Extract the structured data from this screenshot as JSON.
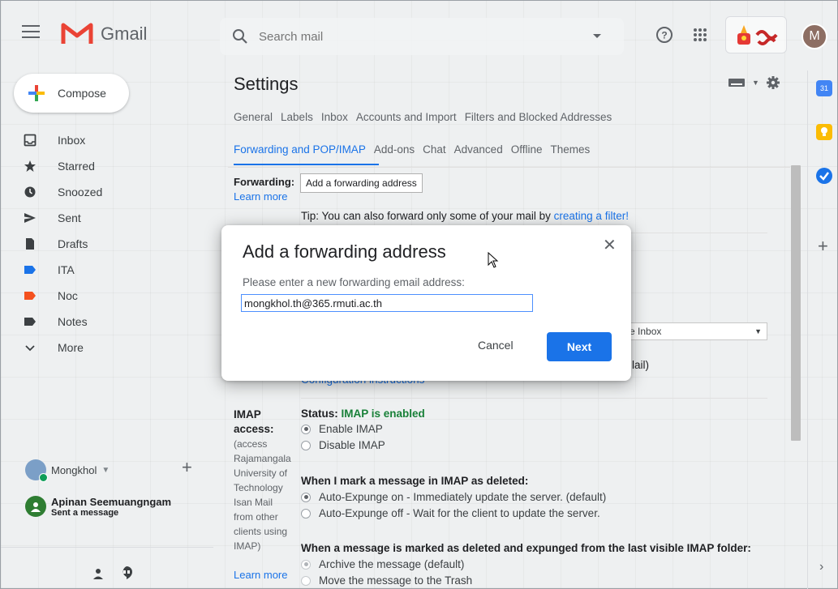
{
  "app": {
    "name": "Gmail"
  },
  "search": {
    "placeholder": "Search mail"
  },
  "compose": {
    "label": "Compose"
  },
  "nav": [
    {
      "label": "Inbox",
      "icon": "inbox-icon"
    },
    {
      "label": "Starred",
      "icon": "star-icon"
    },
    {
      "label": "Snoozed",
      "icon": "clock-icon"
    },
    {
      "label": "Sent",
      "icon": "send-icon"
    },
    {
      "label": "Drafts",
      "icon": "draft-icon"
    },
    {
      "label": "ITA",
      "icon": "label-icon",
      "color": "#1a73e8"
    },
    {
      "label": "Noc",
      "icon": "label-icon",
      "color": "#f4511e"
    },
    {
      "label": "Notes",
      "icon": "label-icon",
      "color": "#3c4043"
    },
    {
      "label": "More",
      "icon": "chevron-down-icon"
    }
  ],
  "account": {
    "name": "Mongkhol",
    "avatar_letter": "M"
  },
  "hangout": {
    "name": "Apinan Seemuangngam",
    "status": "Sent a message"
  },
  "settings": {
    "title": "Settings",
    "tabs_row1": [
      "General",
      "Labels",
      "Inbox",
      "Accounts and Import",
      "Filters and Blocked Addresses"
    ],
    "tabs_row2": [
      "Forwarding and POP/IMAP",
      "Add-ons",
      "Chat",
      "Advanced",
      "Offline",
      "Themes"
    ],
    "active_tab": "Forwarding and POP/IMAP",
    "forwarding": {
      "label": "Forwarding:",
      "learn_more": "Learn more",
      "add_button": "Add a forwarding address",
      "tip_prefix": "Tip: You can also forward only some of your mail by ",
      "tip_link": "creating a filter!"
    },
    "behind_modal": {
      "select_value": "e Inbox",
      "mail_text": "lail)",
      "config_text": "Configuration instructions"
    },
    "imap": {
      "label": "IMAP access:",
      "desc": "(access Rajamangala University of Technology Isan Mail from other clients using IMAP)",
      "learn_more": "Learn more",
      "status_prefix": "Status: ",
      "status_value": "IMAP is enabled",
      "enable": "Enable IMAP",
      "disable": "Disable IMAP",
      "q1": "When I mark a message in IMAP as deleted:",
      "q1_opt1": "Auto-Expunge on - Immediately update the server. (default)",
      "q1_opt2": "Auto-Expunge off - Wait for the client to update the server.",
      "q2": "When a message is marked as deleted and expunged from the last visible IMAP folder:",
      "q2_opt1": "Archive the message (default)",
      "q2_opt2": "Move the message to the Trash"
    }
  },
  "modal": {
    "title": "Add a forwarding address",
    "prompt": "Please enter a new forwarding email address:",
    "value": "mongkhol.th@365.rmuti.ac.th",
    "cancel": "Cancel",
    "next": "Next"
  },
  "colors": {
    "accent": "#1a73e8",
    "imap_enabled": "#188038",
    "gmail_red": "#ea4335"
  }
}
